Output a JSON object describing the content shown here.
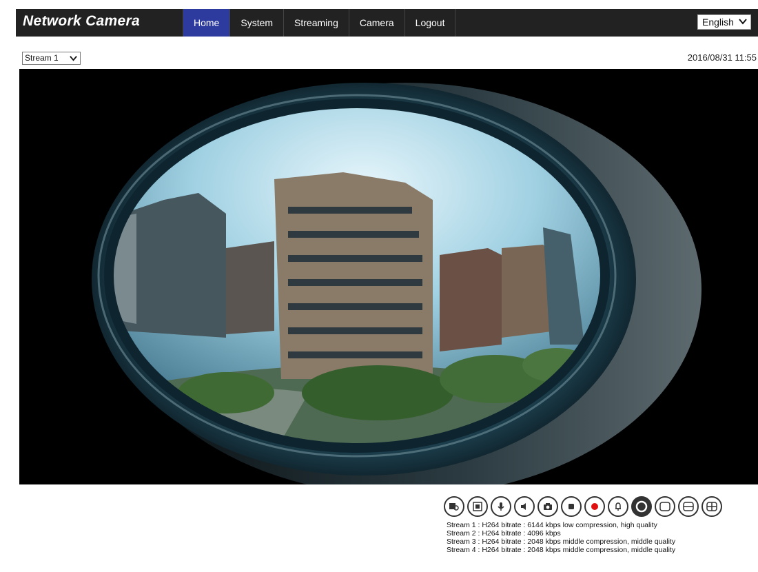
{
  "header": {
    "brand": "Network Camera",
    "nav": [
      {
        "label": "Home",
        "active": true
      },
      {
        "label": "System"
      },
      {
        "label": "Streaming"
      },
      {
        "label": "Camera"
      },
      {
        "label": "Logout"
      }
    ],
    "language": "English"
  },
  "toolbar": {
    "stream_select": "Stream 1",
    "datetime": "2016/08/31 11:55"
  },
  "controls": [
    "snapshot-zoom-icon",
    "fullscreen-icon",
    "microphone-icon",
    "speaker-icon",
    "camera-snapshot-icon",
    "stop-icon",
    "record-icon",
    "alarm-bell-icon",
    "fisheye-circle-icon",
    "single-view-icon",
    "dual-view-icon",
    "quad-view-icon"
  ],
  "stream_info": [
    "Stream 1 : H264 bitrate : 6144 kbps low compression, high quality",
    "Stream 2 : H264 bitrate : 4096 kbps",
    "Stream 3 : H264 bitrate : 2048 kbps middle compression, middle quality",
    "Stream 4 : H264 bitrate : 2048 kbps middle compression, middle quality"
  ],
  "colors": {
    "topbar": "#222222",
    "nav_active": "#2e3b9e",
    "record_red": "#e01010"
  }
}
